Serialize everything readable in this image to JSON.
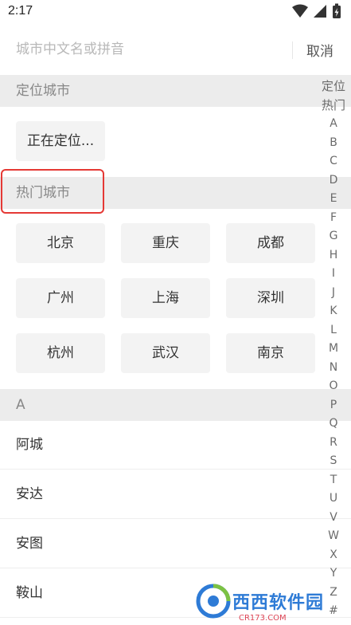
{
  "status": {
    "time": "2:17"
  },
  "search": {
    "placeholder": "城市中文名或拼音",
    "cancel_label": "取消"
  },
  "sections": {
    "located": "定位城市",
    "hot": "热门城市",
    "a": "A"
  },
  "located_city": "正在定位...",
  "hot_cities": [
    "北京",
    "重庆",
    "成都",
    "广州",
    "上海",
    "深圳",
    "杭州",
    "武汉",
    "南京"
  ],
  "city_list": [
    "阿城",
    "安达",
    "安图",
    "鞍山"
  ],
  "index_bar": [
    "定位",
    "热门",
    "A",
    "B",
    "C",
    "D",
    "E",
    "F",
    "G",
    "H",
    "I",
    "J",
    "K",
    "L",
    "M",
    "N",
    "O",
    "P",
    "Q",
    "R",
    "S",
    "T",
    "U",
    "V",
    "W",
    "X",
    "Y",
    "Z",
    "#"
  ],
  "watermark": {
    "brand": "西西软件园",
    "url": "CR173.COM"
  },
  "colors": {
    "highlight": "#e53935",
    "section_bg": "#ececec",
    "chip_bg": "#f3f3f3"
  }
}
